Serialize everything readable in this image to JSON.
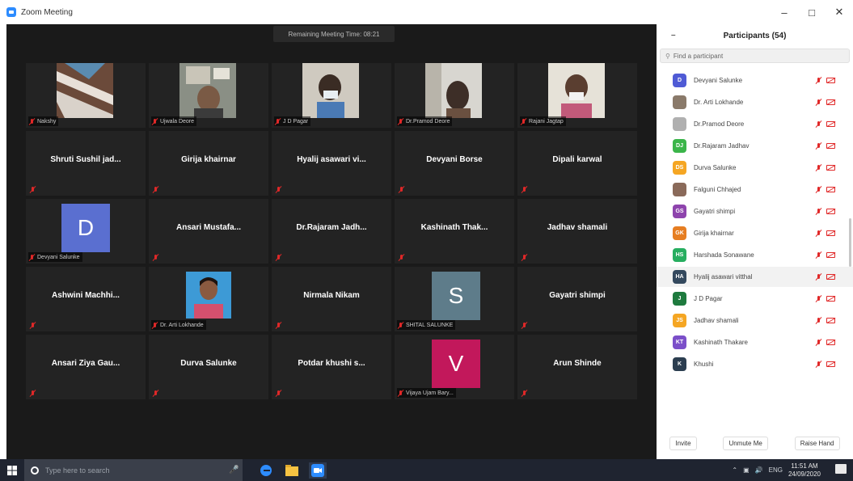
{
  "window": {
    "title": "Zoom Meeting",
    "minimize": "–",
    "maximize": "□",
    "close": "✕"
  },
  "meeting": {
    "timer": "Remaining Meeting Time: 08:21",
    "tiles": [
      {
        "label": "Nakshy"
      },
      {
        "label": "Ujwala Deore"
      },
      {
        "label": "J D Pagar"
      },
      {
        "label": "Dr.Pramod Deore"
      },
      {
        "label": "Rajani Jagtap"
      },
      {
        "name": "Shruti Sushil jad..."
      },
      {
        "name": "Girija khairnar"
      },
      {
        "name": "Hyalij asawari vi..."
      },
      {
        "name": "Devyani Borse"
      },
      {
        "name": "Dipali karwal"
      },
      {
        "initial": "D",
        "label": "Devyani Salunke"
      },
      {
        "name": "Ansari Mustafa..."
      },
      {
        "name": "Dr.Rajaram Jadh..."
      },
      {
        "name": "Kashinath Thak..."
      },
      {
        "name": "Jadhav shamali"
      },
      {
        "name": "Ashwini Machhi..."
      },
      {
        "label": "Dr. Arti Lokhande"
      },
      {
        "name": "Nirmala Nikam"
      },
      {
        "initial": "S",
        "label": "SHITAL SALUNKE"
      },
      {
        "name": "Gayatri shimpi"
      },
      {
        "name": "Ansari Ziya Gau..."
      },
      {
        "name": "Durva Salunke"
      },
      {
        "name": "Potdar khushi s..."
      },
      {
        "initial": "V",
        "label": "Vijaya Ujam Bary..."
      },
      {
        "name": "Arun Shinde"
      }
    ]
  },
  "panel": {
    "collapse": "–",
    "title": "Participants (54)",
    "search_placeholder": "Find a participant",
    "participants": [
      {
        "initials": "D",
        "name": "Devyani Salunke",
        "color": "#4f5bd5"
      },
      {
        "initials": "",
        "name": "Dr. Arti Lokhande",
        "color": "#8a7a6a"
      },
      {
        "initials": "",
        "name": "Dr.Pramod Deore",
        "color": "#b0b0b0"
      },
      {
        "initials": "DJ",
        "name": "Dr.Rajaram Jadhav",
        "color": "#3bb54a"
      },
      {
        "initials": "DS",
        "name": "Durva Salunke",
        "color": "#f5a623"
      },
      {
        "initials": "",
        "name": "Falguni Chhajed",
        "color": "#8a6a5a"
      },
      {
        "initials": "GS",
        "name": "Gayatri shimpi",
        "color": "#8e44ad"
      },
      {
        "initials": "GK",
        "name": "Girija khairnar",
        "color": "#e67e22"
      },
      {
        "initials": "HS",
        "name": "Harshada Sonawane",
        "color": "#27ae60"
      },
      {
        "initials": "HA",
        "name": "Hyalij asawari vitthal",
        "color": "#34495e"
      },
      {
        "initials": "J",
        "name": "J D Pagar",
        "color": "#1e7a3e"
      },
      {
        "initials": "JS",
        "name": "Jadhav shamali",
        "color": "#f5a623"
      },
      {
        "initials": "KT",
        "name": "Kashinath Thakare",
        "color": "#7b4fc9"
      },
      {
        "initials": "K",
        "name": "Khushi",
        "color": "#2c3e50"
      }
    ],
    "invite": "Invite",
    "unmute": "Unmute Me",
    "raise": "Raise Hand"
  },
  "taskbar": {
    "search_placeholder": "Type here to search",
    "lang": "ENG",
    "time": "11:51 AM",
    "date": "24/09/2020"
  }
}
